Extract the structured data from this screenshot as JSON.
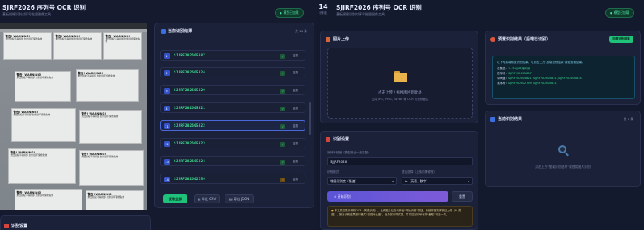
{
  "left_window": {
    "title": "SJRF2026 序列号 OCR 识别",
    "subtitle": "基板规格识别对序号批量图像工具",
    "status_pill": "模型已加载",
    "photo_labels": [
      {
        "title": "警告! WARNING!",
        "body": "未经授权不得拆卸 封条损坏保修失效"
      },
      {
        "title": "警告! WARNING!",
        "body": "未经授权不得拆卸 封条损坏保修失效"
      },
      {
        "title": "警告! WARNING!",
        "body": "未经授权不得拆卸 封条损坏保修失效"
      },
      {
        "title": "警告! WARNING!",
        "body": "未经授权不得拆卸 封条损坏保修失效"
      },
      {
        "title": "警告! WARNING!",
        "body": "未经授权不得拆卸 封条损坏保修失效"
      },
      {
        "title": "警告! WARNING!",
        "body": "未经授权不得拆卸 封条损坏保修失效"
      },
      {
        "title": "警告! WARNING!",
        "body": "未经授权不得拆卸 封条损坏保修失效"
      },
      {
        "title": "警告! WARNING!",
        "body": "未经授权不得拆卸 封条损坏保修失效"
      }
    ],
    "results_panel": {
      "title": "当前识别结果",
      "count": "共 14 条",
      "rows": [
        {
          "num": "1",
          "serial": "SJJRF202605887",
          "copy": "复制",
          "tag": "✓",
          "warn": false
        },
        {
          "num": "2",
          "serial": "SJJRF202605824",
          "copy": "复制",
          "tag": "✓",
          "warn": false
        },
        {
          "num": "3",
          "serial": "SJJRF202605829",
          "copy": "复制",
          "tag": "✓",
          "warn": false
        },
        {
          "num": "4",
          "serial": "SJJRF202605821",
          "copy": "复制",
          "tag": "✓",
          "warn": false
        },
        {
          "num": "11",
          "serial": "SJJRF202605822",
          "copy": "复制",
          "tag": "✓",
          "warn": false
        },
        {
          "num": "12",
          "serial": "SJJRF202605823",
          "copy": "复制",
          "tag": "✓",
          "warn": false
        },
        {
          "num": "13",
          "serial": "SJJRF202605824",
          "copy": "复制",
          "tag": "✓",
          "warn": false
        },
        {
          "num": "14",
          "serial": "SJJRF202602759",
          "copy": "复制",
          "tag": "!",
          "warn": true
        }
      ],
      "btn_copy_all": "复制全部",
      "btn_export_csv": "导出 CSV",
      "btn_export_json": "导出 JSON"
    },
    "settings_title": "识别设置"
  },
  "right_window": {
    "logo_badge": "14",
    "logo_sub": "识别板",
    "title": "SJJRF2026 序列号 OCR 识别",
    "subtitle": "基板规格识别对序号批量图像工具",
    "status_pill": "模型已加载",
    "upload": {
      "title": "图片上传",
      "hint": "点击上传 / 拖拽图片到此处",
      "formats": "支持 JPG、PNG、WEBP 等 OCR 可识别格式"
    },
    "settings": {
      "title": "识别设置",
      "prefix_label": "序列号前缀（模型输出一致匹配）",
      "prefix_value": "SJJRF2026",
      "mode_label": "识别模式",
      "mode_value": "增强识别度（慢速）",
      "lang_label": "语言选择（上传前需修改）",
      "lang_value": "fx（英语、数字）",
      "btn_start": "开始识别",
      "btn_reset": "重置",
      "note": "本工具仅限于解析OCR（离线识别）。上传图片后自动开始“开始识别”按钮，系统将依次解析已上传（fx 英语），按对识别结果进行格式“增强对比度”，批量保存样式提，并将匹配行号有效“截取”可选一次。"
    },
    "preview": {
      "title": "预置识别结果（后端已识别）",
      "btn": "加载识别结果",
      "intro": "以下为后端预置识别结果，可点击上方“加载识别结果”按钮查看结果。",
      "lines": [
        {
          "label": "总数量：",
          "value": "14个SJJRF序列号"
        },
        {
          "label": "首序号：",
          "value": "SJJRF202605887"
        },
        {
          "label": "中间值：",
          "value": "SJJRF202605821, SJJRF202605821, SJJRF202605824"
        },
        {
          "label": "末序号：",
          "value": "SJJRF202602759, SJJRF202605821"
        }
      ]
    },
    "current": {
      "title": "当前识别结果",
      "count": "共 0 条",
      "empty": "点击上方“加载识别结果”或使用图片识别"
    }
  }
}
